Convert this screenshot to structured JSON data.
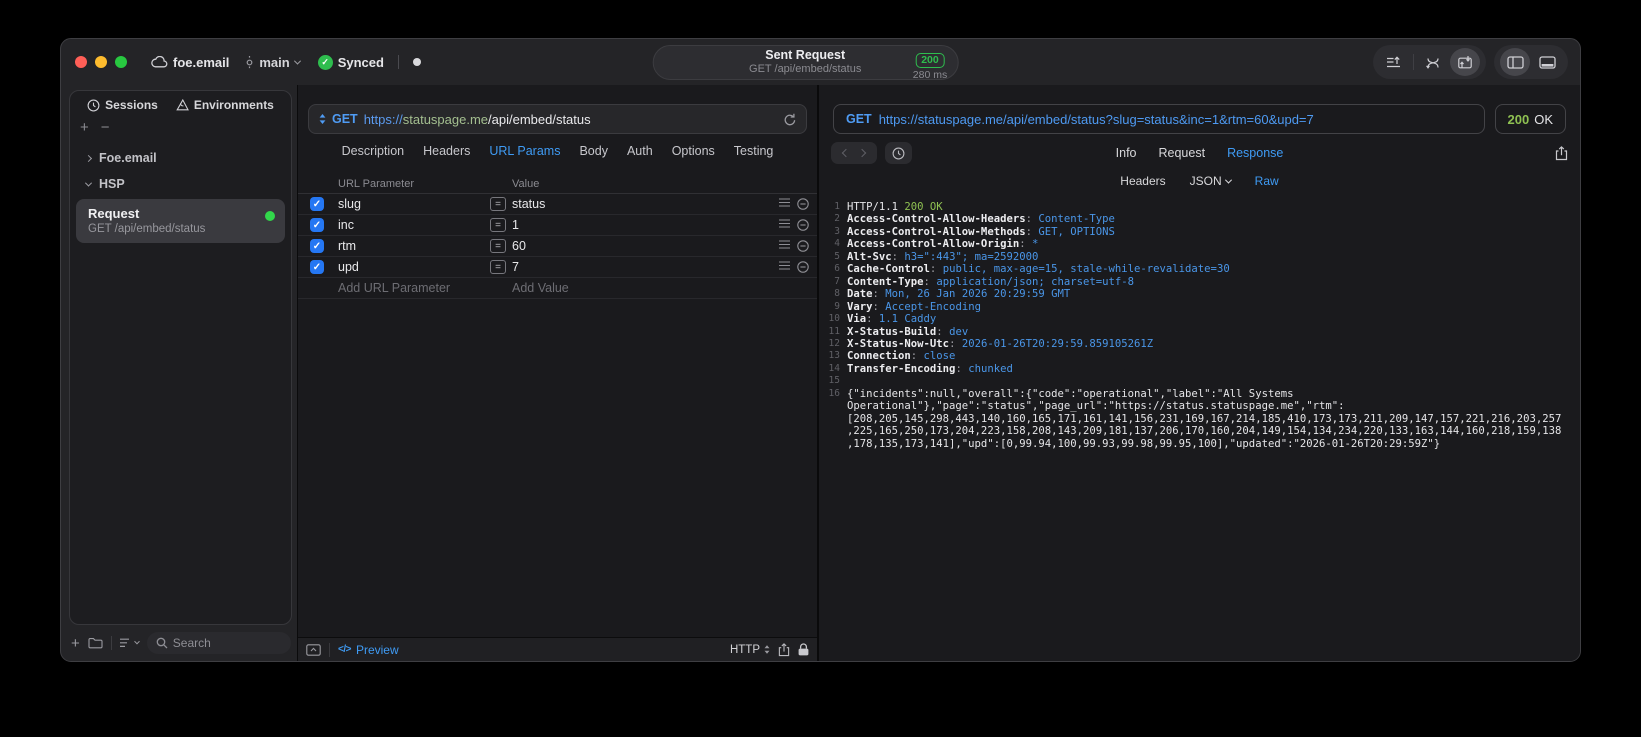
{
  "titlebar": {
    "project": "foe.email",
    "branch": "main",
    "sync_label": "Synced",
    "request_summary": {
      "title": "Sent Request",
      "subtitle": "GET /api/embed/status",
      "status_code": "200",
      "duration": "280 ms"
    }
  },
  "colors": {
    "accent_blue": "#3f9bf4",
    "green": "#32d74b",
    "response_green": "#8fc152",
    "value_blue": "#4a96e8",
    "checkbox_blue": "#2577f3"
  },
  "sidebar": {
    "tabs": [
      {
        "label": "Sessions",
        "icon": "clock-icon"
      },
      {
        "label": "Environments",
        "icon": "environment-icon"
      }
    ],
    "groups": [
      {
        "label": "Foe.email",
        "expanded": false
      },
      {
        "label": "HSP",
        "expanded": true
      }
    ],
    "request_item": {
      "title": "Request",
      "subtitle": "GET /api/embed/status"
    },
    "search_placeholder": "Search"
  },
  "request_panel": {
    "method": "GET",
    "url": {
      "scheme": "https://",
      "host": "statuspage.me",
      "path": "/api/embed/status"
    },
    "tabs": [
      "Description",
      "Headers",
      "URL Params",
      "Body",
      "Auth",
      "Options",
      "Testing"
    ],
    "active_tab": "URL Params",
    "params": {
      "columns": [
        "URL Parameter",
        "Value"
      ],
      "rows": [
        {
          "name": "slug",
          "value": "status",
          "enabled": true
        },
        {
          "name": "inc",
          "value": "1",
          "enabled": true
        },
        {
          "name": "rtm",
          "value": "60",
          "enabled": true
        },
        {
          "name": "upd",
          "value": "7",
          "enabled": true
        }
      ],
      "add_name_placeholder": "Add URL Parameter",
      "add_value_placeholder": "Add Value"
    },
    "footer": {
      "code_glyph": "</>",
      "preview_label": "Preview",
      "protocol_label": "HTTP"
    }
  },
  "response_panel": {
    "method": "GET",
    "url": "https://statuspage.me/api/embed/status?slug=status&inc=1&rtm=60&upd=7",
    "status_code": "200",
    "status_text": "OK",
    "tabs": [
      "Info",
      "Request",
      "Response"
    ],
    "active_tab": "Response",
    "subtabs": [
      {
        "label": "Headers"
      },
      {
        "label": "JSON",
        "chevron": true
      },
      {
        "label": "Raw"
      }
    ],
    "active_subtab": "Raw",
    "status_line": {
      "protocol": "HTTP/1.1 ",
      "status": "200 OK"
    },
    "headers": [
      {
        "name": "Access-Control-Allow-Headers",
        "value": "Content-Type"
      },
      {
        "name": "Access-Control-Allow-Methods",
        "value": "GET, OPTIONS"
      },
      {
        "name": "Access-Control-Allow-Origin",
        "value": "*"
      },
      {
        "name": "Alt-Svc",
        "value": "h3=\":443\"; ma=2592000"
      },
      {
        "name": "Cache-Control",
        "value": "public, max-age=15, stale-while-revalidate=30"
      },
      {
        "name": "Content-Type",
        "value": "application/json; charset=utf-8"
      },
      {
        "name": "Date",
        "value": "Mon, 26 Jan 2026 20:29:59 GMT"
      },
      {
        "name": "Vary",
        "value": "Accept-Encoding"
      },
      {
        "name": "Via",
        "value": "1.1 Caddy"
      },
      {
        "name": "X-Status-Build",
        "value": "dev"
      },
      {
        "name": "X-Status-Now-Utc",
        "value": "2026-01-26T20:29:59.859105261Z"
      },
      {
        "name": "Connection",
        "value": "close"
      },
      {
        "name": "Transfer-Encoding",
        "value": "chunked"
      }
    ],
    "body": "{\"incidents\":null,\"overall\":{\"code\":\"operational\",\"label\":\"All Systems Operational\"},\"page\":\"status\",\"page_url\":\"https://status.statuspage.me\",\"rtm\":[208,205,145,298,443,140,160,165,171,161,141,156,231,169,167,214,185,410,173,173,211,209,147,157,221,216,203,257,225,165,250,173,204,223,158,208,143,209,181,137,206,170,160,204,149,154,134,234,220,133,163,144,160,218,159,138,178,135,173,141],\"upd\":[0,99.94,100,99.93,99.98,99.95,100],\"updated\":\"2026-01-26T20:29:59Z\"}"
  }
}
